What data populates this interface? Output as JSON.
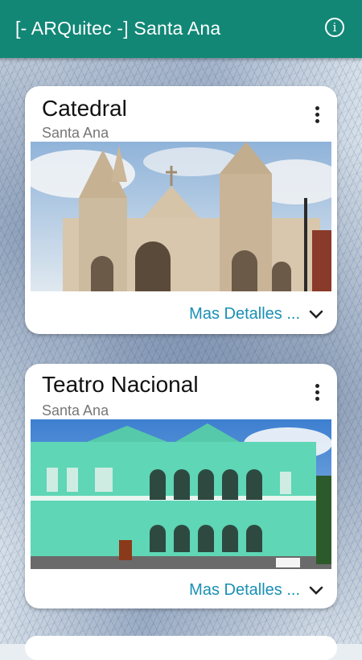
{
  "appbar": {
    "title": "[- ARQuitec -] Santa Ana",
    "info_icon": "info-icon"
  },
  "colors": {
    "appbar": "#128776",
    "link": "#1a8fb5"
  },
  "cards": [
    {
      "title": "Catedral",
      "subtitle": "Santa Ana",
      "details_label": "Mas Detalles ..."
    },
    {
      "title": "Teatro Nacional",
      "subtitle": "Santa Ana",
      "details_label": "Mas Detalles ..."
    }
  ]
}
